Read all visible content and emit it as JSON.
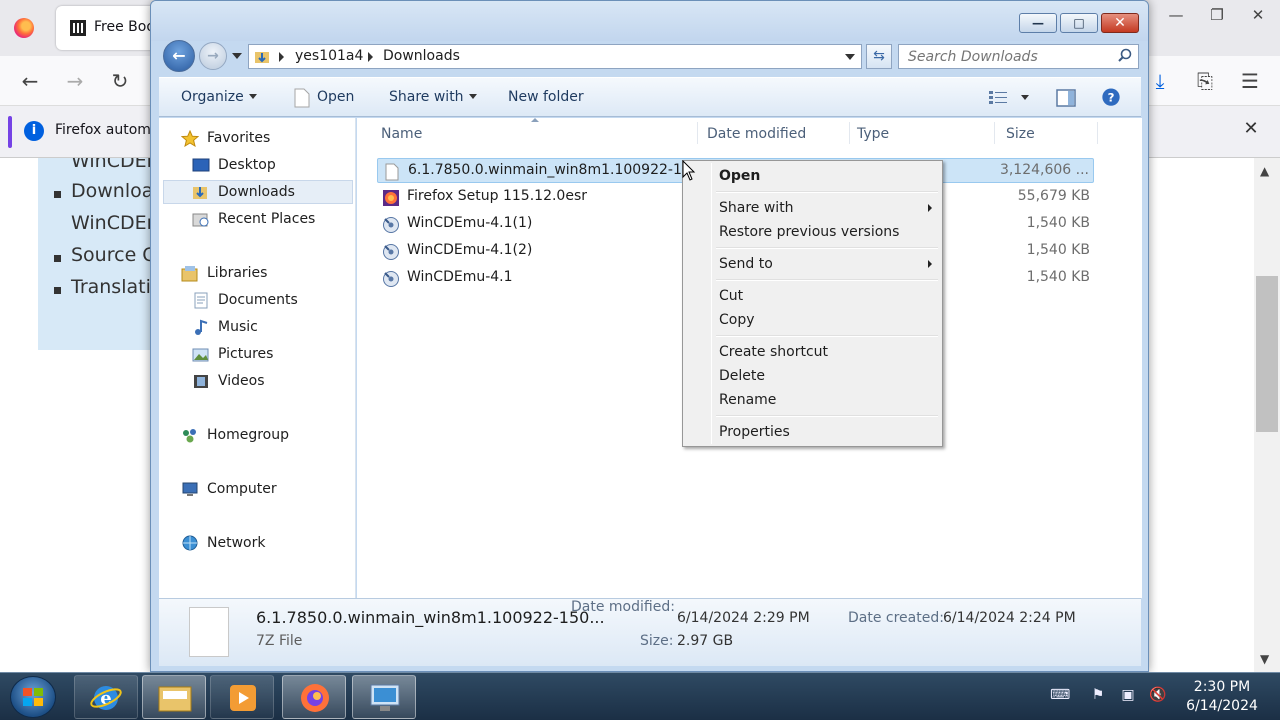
{
  "firefox": {
    "tab_title": "Free Boo",
    "notice_text": "Firefox automa",
    "content_lines": [
      "WinCDEr",
      "Downloa",
      "WinCDEr",
      "Source C",
      "Translati"
    ]
  },
  "explorer": {
    "breadcrumb": [
      "yes101a4",
      "Downloads"
    ],
    "search_placeholder": "Search Downloads",
    "toolbar": {
      "organize": "Organize",
      "open": "Open",
      "share_with": "Share with",
      "new_folder": "New folder"
    },
    "nav": {
      "favorites": "Favorites",
      "desktop": "Desktop",
      "downloads": "Downloads",
      "recent_places": "Recent Places",
      "libraries": "Libraries",
      "documents": "Documents",
      "music": "Music",
      "pictures": "Pictures",
      "videos": "Videos",
      "homegroup": "Homegroup",
      "computer": "Computer",
      "network": "Network"
    },
    "columns": {
      "name": "Name",
      "date_modified": "Date modified",
      "type": "Type",
      "size": "Size"
    },
    "files": [
      {
        "name": "6.1.7850.0.winmain_win8m1.100922-1508...",
        "size": "3,124,606 ...",
        "icon": "file-icon"
      },
      {
        "name": "Firefox Setup 115.12.0esr",
        "size": "55,679 KB",
        "icon": "installer-icon"
      },
      {
        "name": "WinCDEmu-4.1(1)",
        "size": "1,540 KB",
        "icon": "setup-icon"
      },
      {
        "name": "WinCDEmu-4.1(2)",
        "size": "1,540 KB",
        "icon": "setup-icon"
      },
      {
        "name": "WinCDEmu-4.1",
        "size": "1,540 KB",
        "icon": "setup-icon"
      }
    ],
    "details": {
      "file_name": "6.1.7850.0.winmain_win8m1.100922-150...",
      "file_type": "7Z File",
      "date_modified_label": "Date modified:",
      "date_modified_value": "6/14/2024 2:29 PM",
      "size_label": "Size:",
      "size_value": "2.97 GB",
      "date_created_label": "Date created:",
      "date_created_value": "6/14/2024 2:24 PM"
    }
  },
  "context_menu": {
    "open": "Open",
    "share_with": "Share with",
    "restore_previous_versions": "Restore previous versions",
    "send_to": "Send to",
    "cut": "Cut",
    "copy": "Copy",
    "create_shortcut": "Create shortcut",
    "delete": "Delete",
    "rename": "Rename",
    "properties": "Properties"
  },
  "taskbar": {
    "time": "2:30 PM",
    "date": "6/14/2024"
  },
  "colors": {
    "selection": "#cce4f7",
    "window_frame": "#c4d9f0",
    "taskbar": "#1b2f45"
  }
}
